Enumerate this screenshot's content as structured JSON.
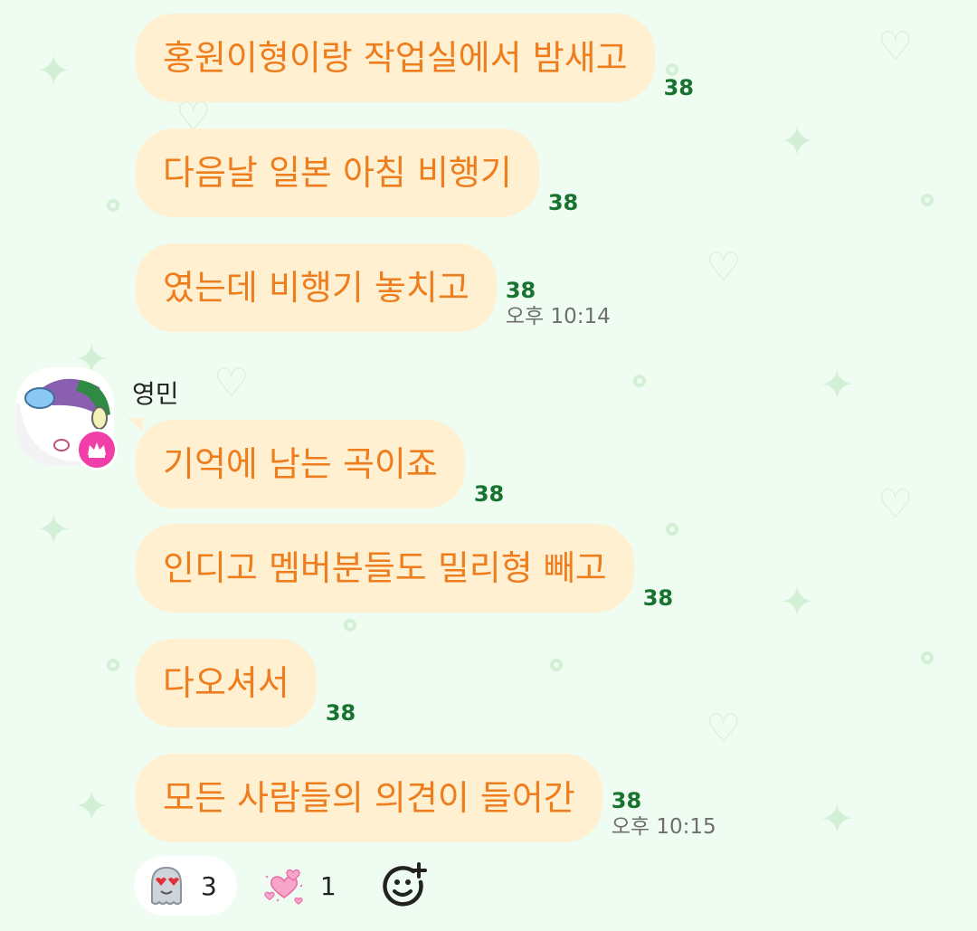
{
  "messages_top": [
    {
      "text": "홍원이형이랑 작업실에서 밤새고",
      "unread": "38",
      "time": ""
    },
    {
      "text": "다음날 일본 아침 비행기",
      "unread": "38",
      "time": ""
    },
    {
      "text": "였는데 비행기 놓치고",
      "unread": "38",
      "time": "오후 10:14"
    }
  ],
  "sender": {
    "name": "영민"
  },
  "messages_sender": [
    {
      "text": "기억에 남는 곡이죠",
      "unread": "38",
      "time": ""
    },
    {
      "text": "인디고 멤버분들도 밀리형 빼고",
      "unread": "38",
      "time": ""
    },
    {
      "text": "다오셔서",
      "unread": "38",
      "time": ""
    },
    {
      "text": "모든 사람들의 의견이 들어간",
      "unread": "38",
      "time": "오후 10:15"
    }
  ],
  "reactions": [
    {
      "icon": "heart-eyes-ghost-icon",
      "count": "3"
    },
    {
      "icon": "pink-hearts-icon",
      "count": "1"
    }
  ],
  "colors": {
    "bubble": "#fff0d2",
    "bubble_text": "#ee7d1d",
    "unread": "#17732e",
    "background": "#effcf1",
    "badge": "#f03fa8"
  }
}
